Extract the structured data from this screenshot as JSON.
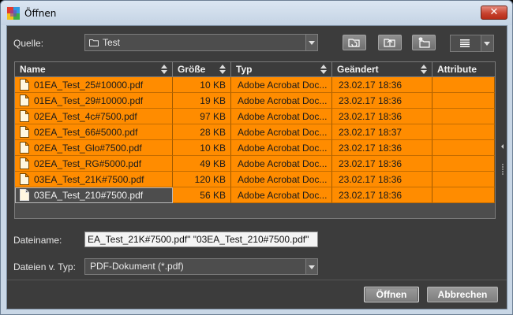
{
  "window": {
    "title": "Öffnen",
    "close_label": "✕"
  },
  "toolbar": {
    "source_label": "Quelle:",
    "source_value": "Test",
    "buttons": [
      "refresh-folder-icon",
      "up-folder-icon",
      "new-folder-icon"
    ],
    "view_icon": "list-view-icon"
  },
  "columns": [
    "Name",
    "Größe",
    "Typ",
    "Geändert",
    "Attribute"
  ],
  "files": [
    {
      "name": "01EA_Test_25#10000.pdf",
      "size": "10 KB",
      "type": "Adobe Acrobat Doc...",
      "modified": "23.02.17 18:36",
      "attr": ""
    },
    {
      "name": "01EA_Test_29#10000.pdf",
      "size": "19 KB",
      "type": "Adobe Acrobat Doc...",
      "modified": "23.02.17 18:36",
      "attr": ""
    },
    {
      "name": "02EA_Test_4c#7500.pdf",
      "size": "97 KB",
      "type": "Adobe Acrobat Doc...",
      "modified": "23.02.17 18:36",
      "attr": ""
    },
    {
      "name": "02EA_Test_66#5000.pdf",
      "size": "28 KB",
      "type": "Adobe Acrobat Doc...",
      "modified": "23.02.17 18:37",
      "attr": ""
    },
    {
      "name": "02EA_Test_Glo#7500.pdf",
      "size": "10 KB",
      "type": "Adobe Acrobat Doc...",
      "modified": "23.02.17 18:36",
      "attr": ""
    },
    {
      "name": "02EA_Test_RG#5000.pdf",
      "size": "49 KB",
      "type": "Adobe Acrobat Doc...",
      "modified": "23.02.17 18:36",
      "attr": ""
    },
    {
      "name": "03EA_Test_21K#7500.pdf",
      "size": "120 KB",
      "type": "Adobe Acrobat Doc...",
      "modified": "23.02.17 18:36",
      "attr": ""
    },
    {
      "name": "03EA_Test_210#7500.pdf",
      "size": "56 KB",
      "type": "Adobe Acrobat Doc...",
      "modified": "23.02.17 18:36",
      "attr": ""
    }
  ],
  "focused_row": 7,
  "filename": {
    "label": "Dateiname:",
    "value": "EA_Test_21K#7500.pdf\" \"03EA_Test_210#7500.pdf\""
  },
  "filetype": {
    "label": "Dateien v. Typ:",
    "value": "PDF-Dokument (*.pdf)"
  },
  "actions": {
    "open_label": "Öffnen",
    "cancel_label": "Abbrechen"
  },
  "colors": {
    "selection": "#ff8c00",
    "background": "#3c3c3c",
    "titlebar": "#c9d7e6"
  }
}
